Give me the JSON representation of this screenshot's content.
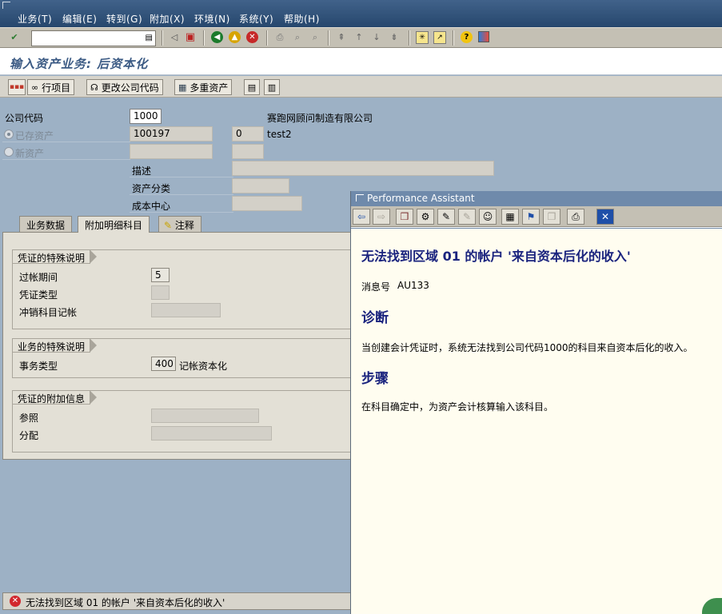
{
  "menu": {
    "items": [
      "业务(T)",
      "编辑(E)",
      "转到(G)",
      "附加(X)",
      "环境(N)",
      "系统(Y)",
      "帮助(H)"
    ]
  },
  "toolbar": {
    "command_value": "",
    "icons": [
      "enter-check-icon",
      "history-icon",
      "back-triangle-icon",
      "save-icon",
      "back-icon",
      "exit-icon",
      "cancel-icon",
      "print-icon",
      "find-icon",
      "find-next-icon",
      "first-page-icon",
      "prev-page-icon",
      "next-page-icon",
      "last-page-icon",
      "new-session-icon",
      "shortcut-icon",
      "help-icon",
      "layout-icon"
    ]
  },
  "title": "输入资产业务: 后资本化",
  "app_toolbar": {
    "line_items_label": "行项目",
    "change_company_label": "更改公司代码",
    "multiple_assets_label": "多重资产"
  },
  "header": {
    "company_code_label": "公司代码",
    "company_code_value": "1000",
    "company_name": "赛跑网顾问制造有限公司",
    "existing_asset_label": "已存资产",
    "existing_asset_value": "100197",
    "sub_number_value": "0",
    "asset_desc": "test2",
    "new_asset_label": "新资产",
    "description_label": "描述",
    "asset_class_label": "资产分类",
    "cost_center_label": "成本中心"
  },
  "tabs": [
    {
      "label": "业务数据"
    },
    {
      "label": "附加明细科目"
    },
    {
      "label": "注释"
    }
  ],
  "groups": {
    "doc_special": {
      "title": "凭证的特殊说明",
      "posting_period_label": "过帐期间",
      "posting_period_value": "5",
      "doc_type_label": "凭证类型",
      "offset_label": "冲销科目记帐"
    },
    "trans_special": {
      "title": "业务的特殊说明",
      "trans_type_label": "事务类型",
      "trans_type_value": "400",
      "trans_type_text": "记帐资本化"
    },
    "doc_additional": {
      "title": "凭证的附加信息",
      "reference_label": "参照",
      "assignment_label": "分配"
    }
  },
  "status": {
    "message": "无法找到区域 01 的帐户 '来自资本后化的收入'"
  },
  "performance_assistant": {
    "title": "Performance Assistant",
    "heading": "无法找到区域  01 的帐户  '来自资本后化的收入'",
    "message_no_label": "消息号",
    "message_no_value": "AU133",
    "diagnosis_title": "诊断",
    "diagnosis_text": "当创建会计凭证时，系统无法找到公司代码1000的科目来自资本后化的收入。",
    "procedure_title": "步骤",
    "procedure_text": "在科目确定中，为资产会计核算输入该科目。"
  },
  "colors": {
    "menubar": "#2f5078",
    "background": "#9db1c5",
    "heading_blue": "#1a237e",
    "error_red": "#d2272c"
  }
}
